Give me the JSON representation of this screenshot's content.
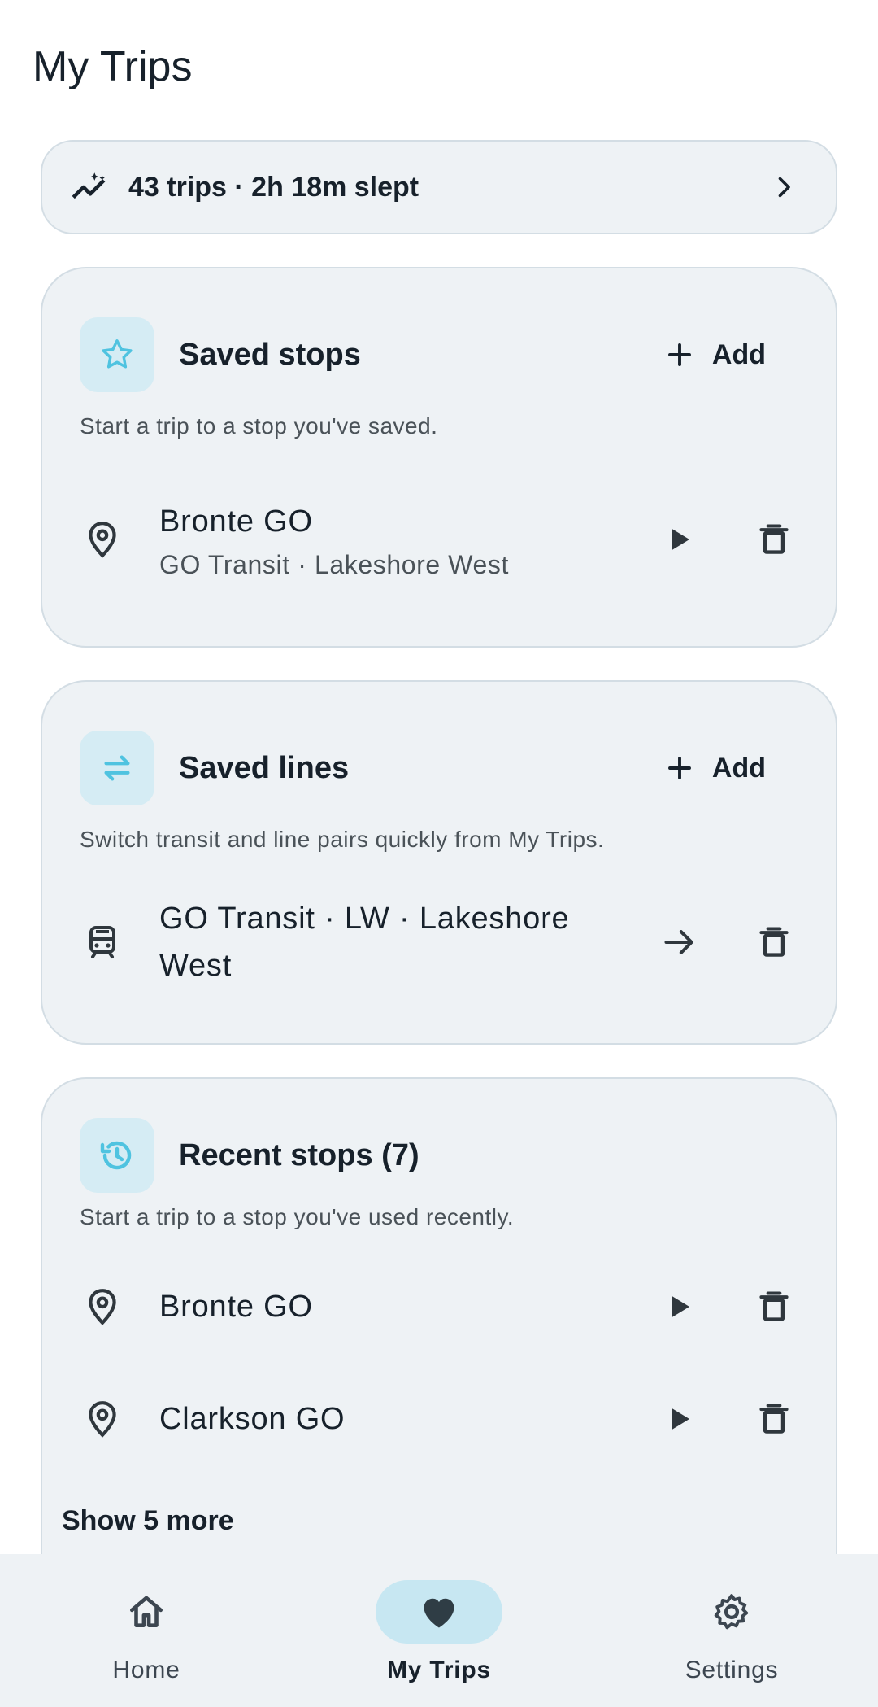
{
  "page": {
    "title": "My Trips"
  },
  "stats": {
    "text": "43 trips · 2h 18m slept",
    "icon": "insights-icon"
  },
  "saved_stops": {
    "title": "Saved stops",
    "add_label": "Add",
    "subtitle": "Start a trip to a stop you've saved.",
    "items": [
      {
        "name": "Bronte GO",
        "detail": "GO Transit · Lakeshore West"
      }
    ]
  },
  "saved_lines": {
    "title": "Saved lines",
    "add_label": "Add",
    "subtitle": "Switch transit and line pairs quickly from My Trips.",
    "items": [
      {
        "name": "GO Transit · LW · Lakeshore West"
      }
    ]
  },
  "recent_stops": {
    "title": "Recent stops (7)",
    "subtitle": "Start a trip to a stop you've used recently.",
    "items": [
      {
        "name": "Bronte GO"
      },
      {
        "name": "Clarkson GO"
      }
    ],
    "show_more_label": "Show 5 more"
  },
  "nav": {
    "items": [
      {
        "label": "Home",
        "icon": "home-icon"
      },
      {
        "label": "My Trips",
        "icon": "heart-icon",
        "active": true
      },
      {
        "label": "Settings",
        "icon": "gear-icon"
      }
    ]
  },
  "colors": {
    "accent": "#4fc3e0",
    "card_bg": "#eef2f5",
    "nav_active": "#c7e7f2"
  }
}
